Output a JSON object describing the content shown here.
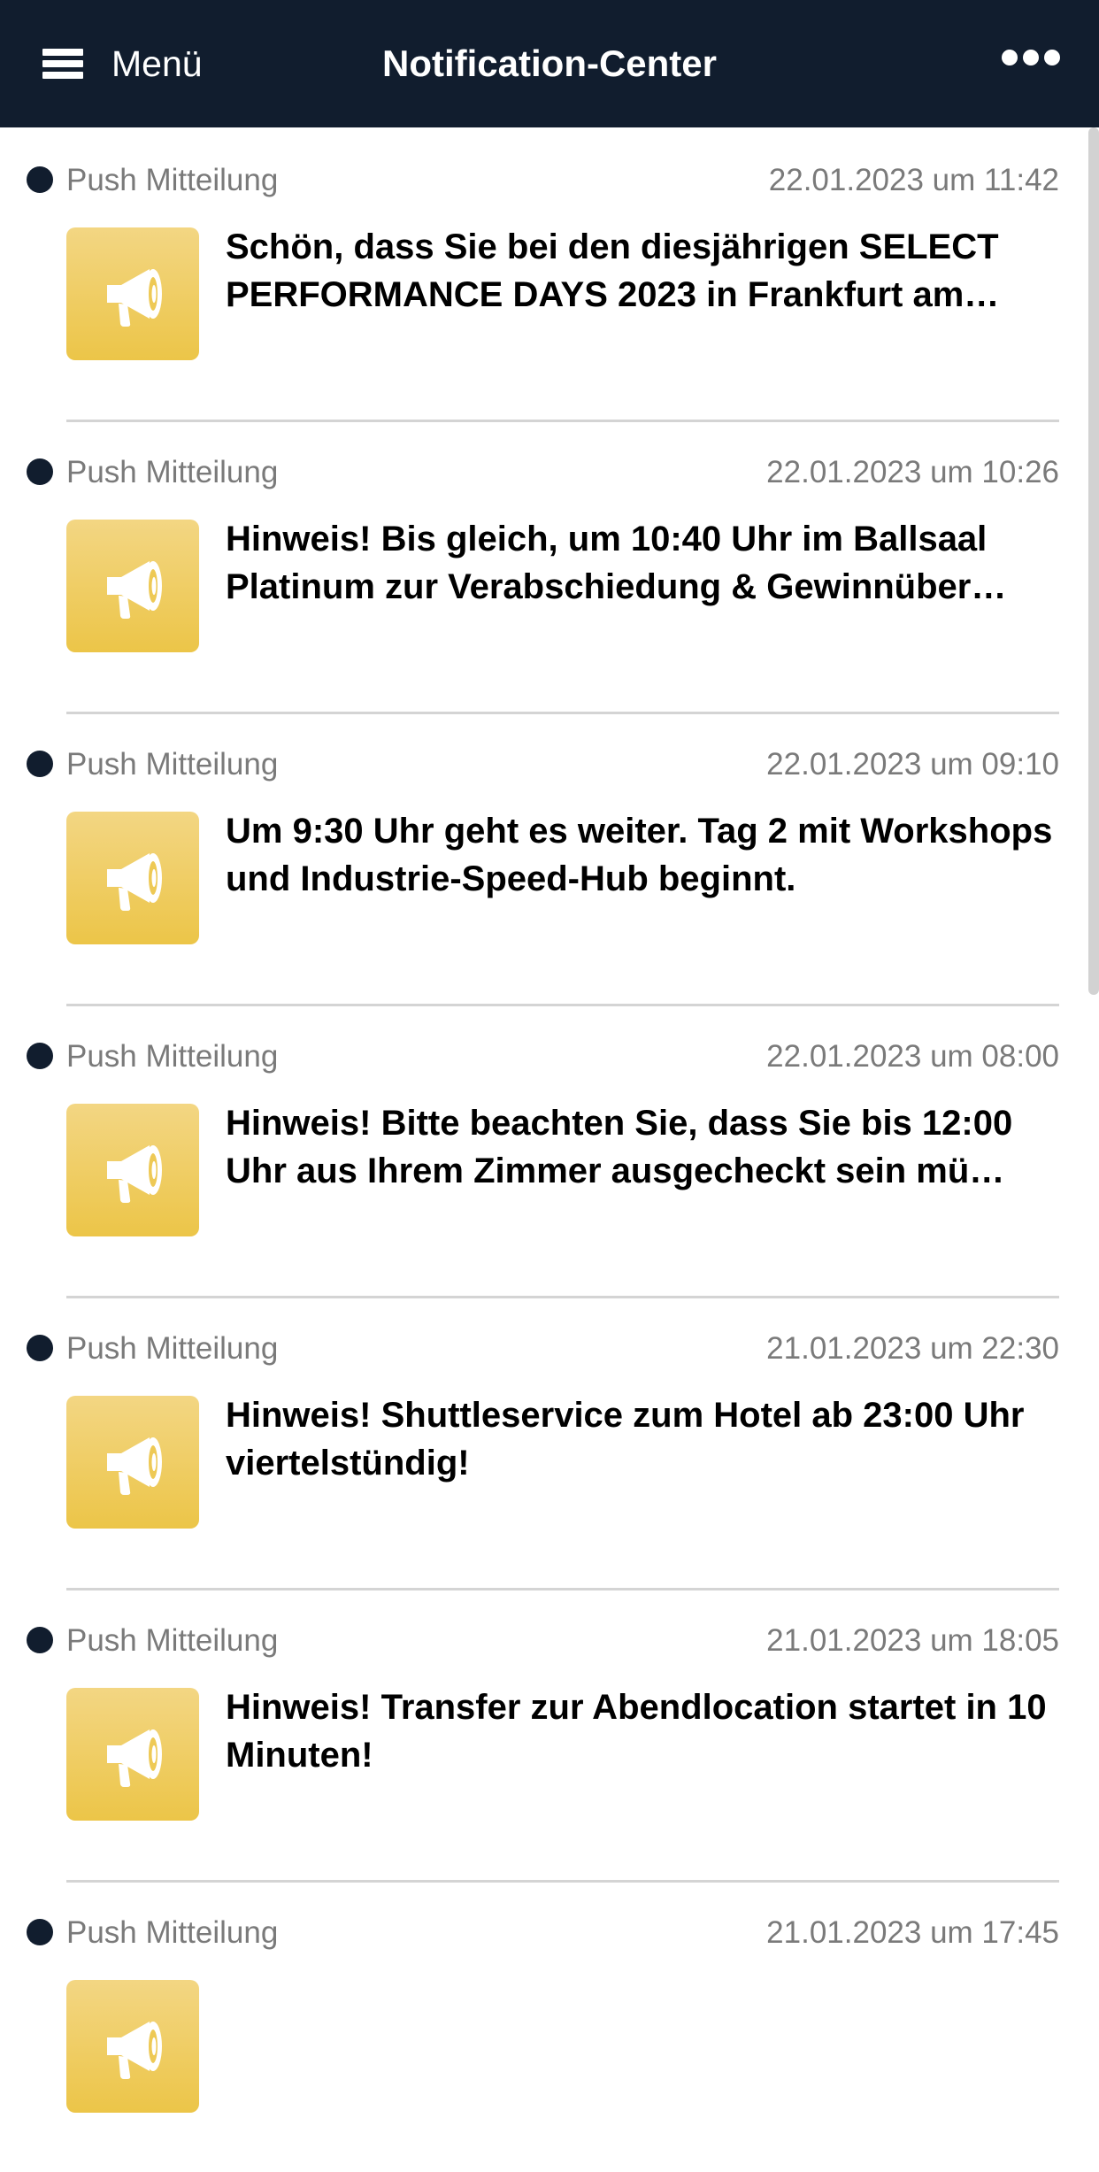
{
  "header": {
    "menu_label": "Menü",
    "title": "Notification-Center",
    "bar_color": "#111d2e"
  },
  "icons": {
    "menu": "hamburger-icon",
    "more": "more-dots-icon",
    "notification": "megaphone-icon"
  },
  "colors": {
    "icon_tile": "#ecc548",
    "unread_dot": "#111d2e",
    "meta_text": "#7a7a7a"
  },
  "notifications": [
    {
      "type": "Push Mitteilung",
      "date": "22.01.2023 um 11:42",
      "text": "Schön, dass Sie bei den diesjährigen SELECT PERFORMANCE DAYS 2023 in Frankfurt am…"
    },
    {
      "type": "Push Mitteilung",
      "date": "22.01.2023 um 10:26",
      "text": "Hinweis! Bis gleich, um 10:40 Uhr im Ballsaal Platinum zur Verabschiedung & Gewinnüber…"
    },
    {
      "type": "Push Mitteilung",
      "date": "22.01.2023 um 09:10",
      "text": "Um 9:30 Uhr geht es weiter. Tag 2 mit Workshops und Industrie-Speed-Hub beginnt."
    },
    {
      "type": "Push Mitteilung",
      "date": "22.01.2023 um 08:00",
      "text": "Hinweis! Bitte beachten Sie, dass Sie bis 12:00 Uhr aus Ihrem Zimmer ausgecheckt sein mü…"
    },
    {
      "type": "Push Mitteilung",
      "date": "21.01.2023 um 22:30",
      "text": "Hinweis! Shuttleservice zum Hotel ab 23:00 Uhr viertelstündig!"
    },
    {
      "type": "Push Mitteilung",
      "date": "21.01.2023 um 18:05",
      "text": "Hinweis! Transfer zur Abendlocation startet in 10 Minuten!"
    },
    {
      "type": "Push Mitteilung",
      "date": "21.01.2023 um 17:45",
      "text": ""
    }
  ]
}
